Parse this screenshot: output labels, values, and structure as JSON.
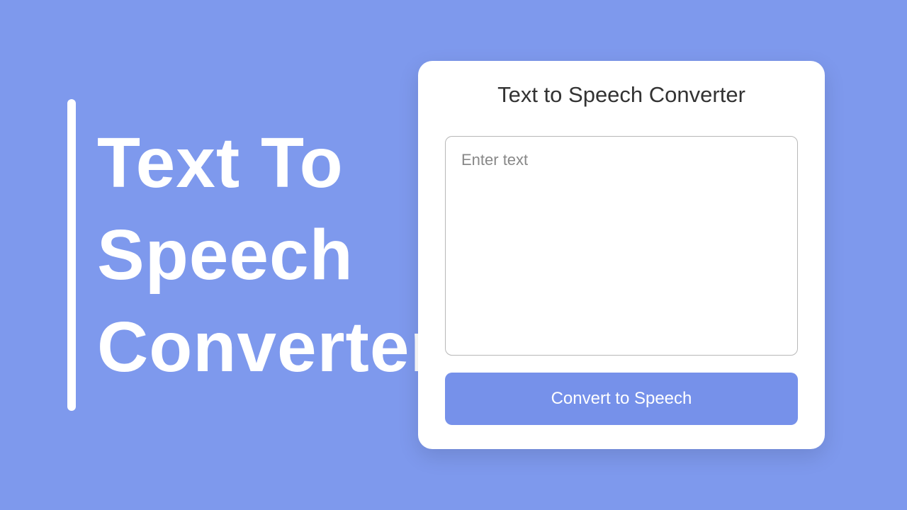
{
  "hero": {
    "title_line1": "Text To",
    "title_line2": "Speech",
    "title_line3": "Converter"
  },
  "card": {
    "title": "Text to Speech Converter",
    "input_placeholder": "Enter text",
    "input_value": "",
    "convert_button_label": "Convert to Speech"
  },
  "colors": {
    "background": "#7e99ed",
    "card_background": "#ffffff",
    "button_background": "#7691ea",
    "text_dark": "#333333"
  }
}
